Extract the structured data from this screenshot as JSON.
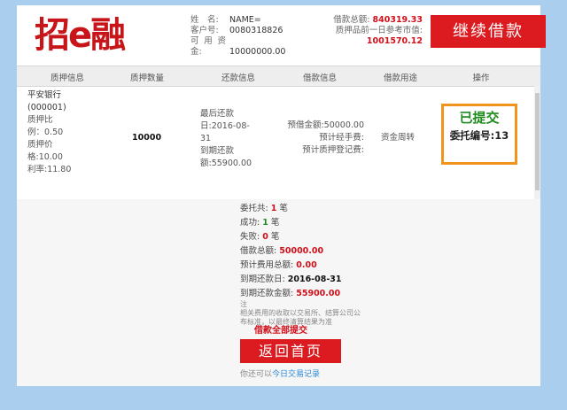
{
  "header": {
    "logo_text": "招e融",
    "name_label": "姓　名:",
    "name_value": "NAME=",
    "customer_label": "客户号:",
    "customer_value": "0080318826",
    "funds_label": "可用资金:",
    "funds_value": "10000000.00",
    "loan_total_label": "借款总额:",
    "loan_total_value": "840319.33",
    "collateral_label": "质押品前一日参考市值:",
    "collateral_value": "1001570.12",
    "continue_button": "继续借款"
  },
  "table": {
    "columns": [
      "质押信息",
      "质押数量",
      "还款信息",
      "借款信息",
      "借款用途",
      "操作"
    ],
    "row": {
      "pledge_lines": [
        "平安银行",
        "(000001)",
        "质押比",
        "例：0.50",
        "质押价",
        "格:10.00",
        "利率:11.80"
      ],
      "quantity": "10000",
      "repay_lines": [
        "最后还款",
        "日:2016-08-",
        "31",
        "到期还款",
        "额:55900.00"
      ],
      "loan_lines": [
        "预借金额:50000.00",
        "预计经手费:",
        "预计质押登记费:"
      ],
      "purpose": "资金周转",
      "status": "已提交",
      "order_no": "委托编号:13"
    }
  },
  "summary": {
    "total_label": "委托共:",
    "total_value": "1",
    "unit": "笔",
    "success_label": "成功:",
    "success_value": "1",
    "fail_label": "失败:",
    "fail_value": "0",
    "loan_total_label": "借款总额:",
    "loan_total_value": "50000.00",
    "fee_label": "预计费用总额:",
    "fee_value": "0.00",
    "due_date_label": "到期还款日:",
    "due_date_value": "2016-08-31",
    "due_amount_label": "到期还款金额:",
    "due_amount_value": "55900.00",
    "note_label": "注",
    "note_lines": [
      "相关费用的收取以交易所、结算公司公",
      "布标准，以最终清算结果为准"
    ],
    "all_submitted": "借款全部提交",
    "back_button": "返回首页",
    "footer_text": "你还可以",
    "footer_link": "今日交易记录"
  },
  "colors": {
    "accent_red": "#db1b20",
    "page_bg": "#a9ceee",
    "status_green": "#1e8c1e",
    "highlight_orange": "#f0941e"
  }
}
